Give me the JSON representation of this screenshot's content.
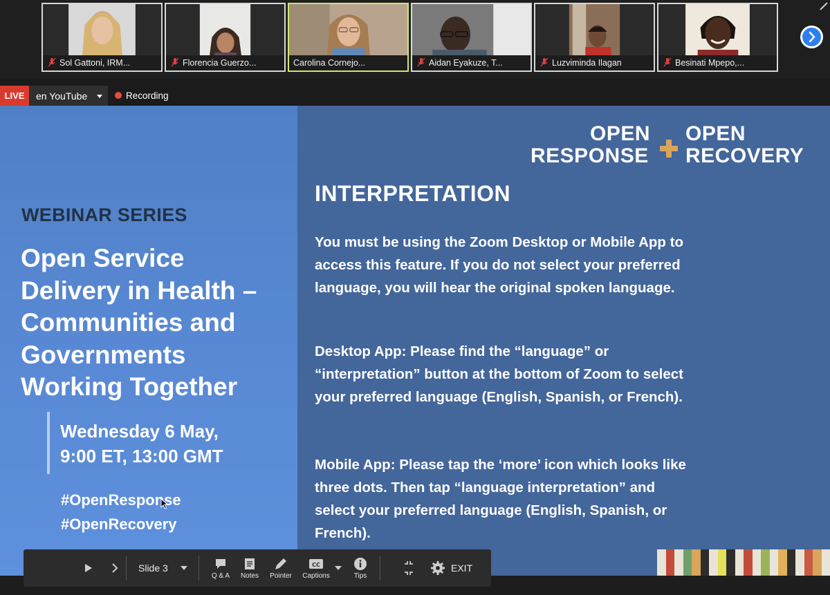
{
  "participants": [
    {
      "name": "Sol Gattoni,  IRM...",
      "muted": true,
      "active": false
    },
    {
      "name": "Florencia Guerzo...",
      "muted": true,
      "active": false
    },
    {
      "name": "Carolina Cornejo...",
      "muted": false,
      "active": true
    },
    {
      "name": "Aidan Eyakuze, T...",
      "muted": true,
      "active": false
    },
    {
      "name": "Luzviminda Ilagan",
      "muted": true,
      "active": false
    },
    {
      "name": "Besinati Mpepo,...",
      "muted": true,
      "active": false
    }
  ],
  "livebar": {
    "live_label": "LIVE",
    "stream_target": "en YouTube",
    "recording_label": "Recording"
  },
  "slide": {
    "series_label": "WEBINAR SERIES",
    "title_lines": [
      "Open Service",
      "Delivery in Health –",
      "Communities and",
      "Governments",
      "Working Together"
    ],
    "date_line1": "Wednesday 6 May,",
    "date_line2": "9:00 ET, 13:00 GMT",
    "hashtag1": "#OpenResponse",
    "hashtag2": "#OpenRecovery",
    "logo": {
      "open1": "OPEN",
      "response": "RESPONSE",
      "open2": "OPEN",
      "recovery": "RECOVERY"
    },
    "heading": "INTERPRETATION",
    "paragraphs": [
      "You must be using the Zoom Desktop or Mobile App to access this feature. If you do not select your preferred language, you will hear the original spoken language.",
      "Desktop App: Please find the “language” or “interpretation” button at the bottom of Zoom to select your preferred language (English, Spanish, or French).",
      "Mobile App: Please tap the ‘more’ icon which looks like three dots. Then tap “language interpretation” and select your preferred language (English, Spanish, or French)."
    ]
  },
  "toolbar": {
    "slide_select": "Slide 3",
    "qa_label": "Q & A",
    "notes_label": "Notes",
    "pointer_label": "Pointer",
    "captions_label": "Captions",
    "tips_label": "Tips",
    "exit_label": "EXIT"
  },
  "colors": {
    "live_red": "#d83a2d",
    "left_panel_blue": "#5a8ad6",
    "right_panel_blue": "#43669b",
    "accent_gold": "#d9a55b",
    "active_speaker": "#cfe86a"
  },
  "stripe_colors": [
    "#e9e4d8",
    "#c24b3c",
    "#e9e4d8",
    "#6fa06a",
    "#d9a55b",
    "#2d2d2d",
    "#e9e4d8",
    "#e4e25a",
    "#2d2d2d",
    "#e9e4d8",
    "#c24b3c",
    "#e9e4d8",
    "#9bb35a",
    "#e9e4d8",
    "#e0b15a",
    "#2d2d2d",
    "#e9e4d8",
    "#c85a46",
    "#d9a55b",
    "#e9e4d8"
  ]
}
